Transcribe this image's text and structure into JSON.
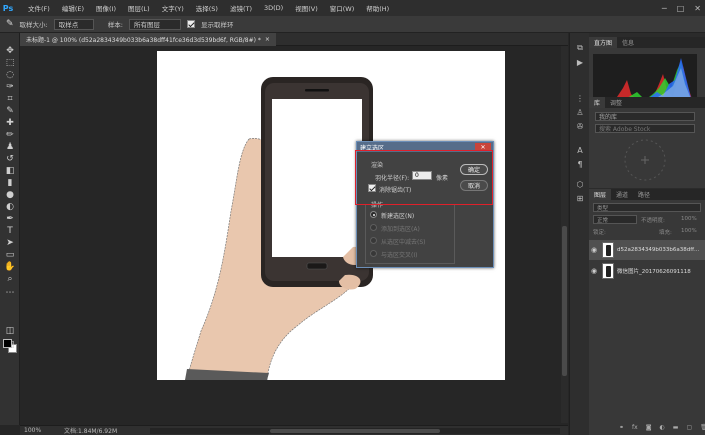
{
  "app": {
    "logo": "Ps",
    "menu": [
      "文件(F)",
      "编辑(E)",
      "图像(I)",
      "图层(L)",
      "文字(Y)",
      "选择(S)",
      "滤镜(T)",
      "3D(D)",
      "视图(V)",
      "窗口(W)",
      "帮助(H)"
    ],
    "window_controls": [
      "─",
      "□",
      "✕"
    ]
  },
  "options_bar": {
    "sample_size_label": "取样大小:",
    "sample_size_value": "取样点",
    "sample_label": "样本:",
    "sample_value": "所有图层",
    "show_ring_label": "显示取样环"
  },
  "document_tab": {
    "title": "未标题-1 @ 100% (d52a2834349b033b6a38dff41fce36d3d539bd6f, RGB/8#) *",
    "close": "×"
  },
  "status_bar": {
    "zoom": "100%",
    "doc_size": "文档:1.84M/6.92M"
  },
  "panels": {
    "histogram_tabs": [
      "直方图",
      "信息"
    ],
    "library_tabs": [
      "库",
      "调整"
    ],
    "library_select": "我的库",
    "library_search": "搜索 Adobe Stock",
    "layers_tabs": [
      "图层",
      "通道",
      "路径"
    ],
    "layer_filter": "类型",
    "blend_mode": "正常",
    "opacity_label": "不透明度:",
    "opacity_value": "100%",
    "lock_label": "锁定:",
    "fill_label": "填充:",
    "fill_value": "100%",
    "layers": [
      {
        "name": "d52a2834349b033b6a38dff...",
        "selected": true
      },
      {
        "name": "微信图片_20170626091118",
        "selected": false
      }
    ]
  },
  "dialog": {
    "title": "建立选区",
    "close": "✕",
    "render_group": "渲染",
    "feather_label": "羽化半径(F):",
    "feather_value": "0",
    "feather_unit": "像素",
    "antialias_label": "消除锯齿(T)",
    "ok": "确定",
    "cancel": "取消",
    "operation_group": "操作",
    "ops": [
      "新建选区(N)",
      "添加到选区(A)",
      "从选区中减去(S)",
      "与选区交叉(I)"
    ]
  },
  "colors": {
    "ui_dark": "#2b2b2b",
    "dialog_title": "#566d8a",
    "highlight_box": "#e0202a",
    "ps_blue": "#31a8ff"
  }
}
